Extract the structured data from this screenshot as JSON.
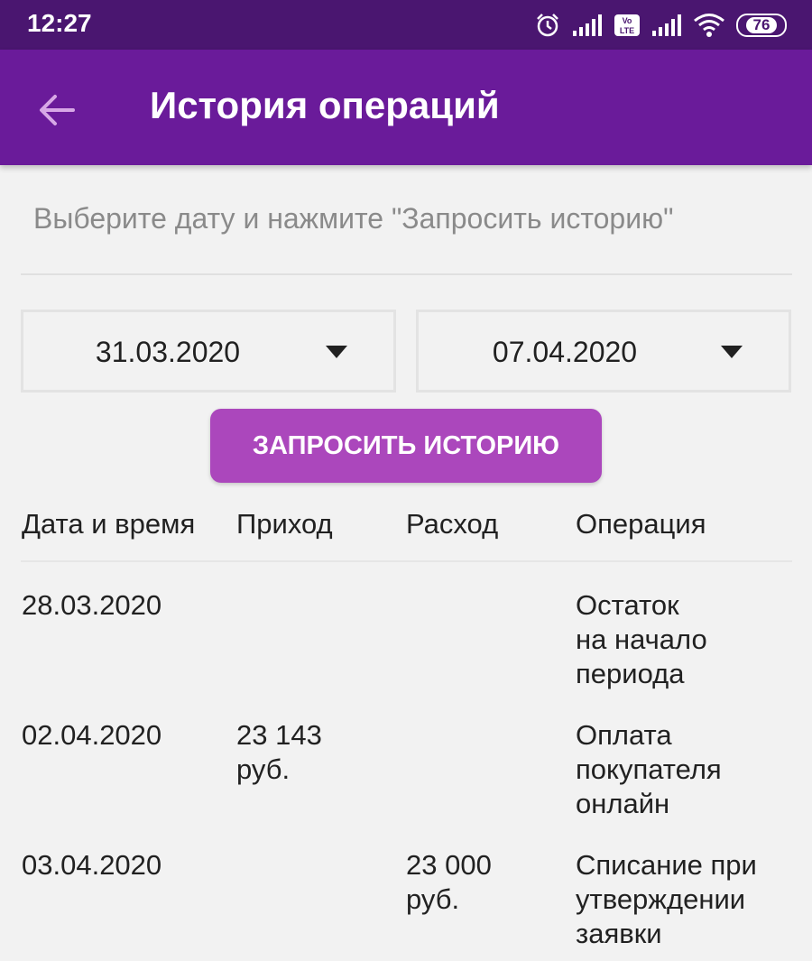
{
  "status_bar": {
    "time": "12:27",
    "battery": "76",
    "icons": [
      "alarm-icon",
      "signal-icon",
      "volte-icon",
      "signal-icon",
      "wifi-icon",
      "battery-icon"
    ]
  },
  "app_bar": {
    "title": "История операций",
    "back_icon": "arrow-left-icon",
    "color": "#6a1b9a"
  },
  "form": {
    "hint": "Выберите дату и нажмите \"Запросить историю\"",
    "date_from": "31.03.2020",
    "date_to": "07.04.2020",
    "request_button_label": "ЗАПРОСИТЬ ИСТОРИЮ",
    "button_color": "#ab47bc"
  },
  "table": {
    "headers": {
      "date": "Дата и время",
      "income": "Приход",
      "expense": "Расход",
      "operation": "Операция"
    },
    "rows": [
      {
        "date": "28.03.2020",
        "income": [],
        "expense": [],
        "operation": [
          "Остаток",
          "на начало",
          "периода"
        ]
      },
      {
        "date": "02.04.2020",
        "income": [
          "23 143",
          "руб."
        ],
        "expense": [],
        "operation": [
          "Оплата",
          "покупателя",
          "онлайн"
        ]
      },
      {
        "date": "03.04.2020",
        "income": [],
        "expense": [
          "23 000",
          "руб."
        ],
        "operation": [
          "Списание при",
          "утверждении",
          "заявки"
        ]
      }
    ]
  }
}
